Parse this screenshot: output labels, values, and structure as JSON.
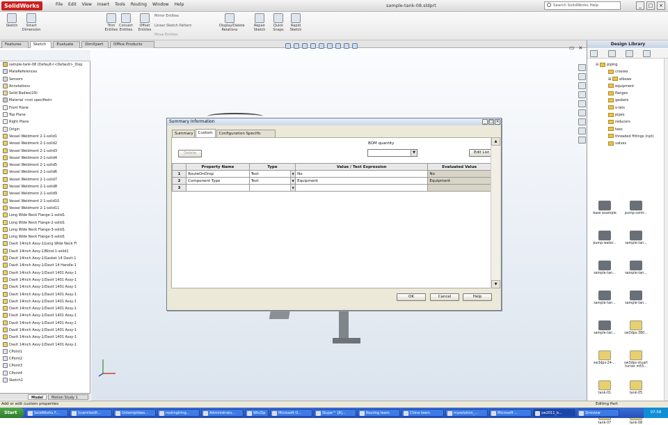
{
  "app": {
    "logo": "SolidWorks",
    "doc_title": "sample-tank-08.sldprt",
    "search_placeholder": "Search SolidWorks Help"
  },
  "menu": [
    "File",
    "Edit",
    "View",
    "Insert",
    "Tools",
    "Routing",
    "Window",
    "Help"
  ],
  "ribbon": {
    "buttons": [
      "Sketch",
      "Smart Dimension",
      "Trim Entities",
      "Convert Entities",
      "Offset Entities",
      "Display/Delete Relations",
      "Repair Sketch",
      "Quick Snaps",
      "Rapid Sketch"
    ],
    "mirror": "Mirror Entities",
    "linear_pattern": "Linear Sketch Pattern",
    "move": "Move Entities"
  },
  "command_tabs": [
    "Features",
    "Sketch",
    "Evaluate",
    "DimXpert",
    "Office Products"
  ],
  "feature_tree": {
    "root": "sample-tank-08  (Default<<Default>_Disp",
    "items": [
      "MateReferences",
      "Sensors",
      "Annotations",
      "Solid Bodies(29)",
      "Material <not specified>",
      "Front Plane",
      "Top Plane",
      "Right Plane",
      "Origin",
      "Vessel Weldment 2-1-solid1",
      "Vessel Weldment 2-1-solid2",
      "Vessel Weldment 2-1-solid3",
      "Vessel Weldment 2-1-solid4",
      "Vessel Weldment 2-1-solid5",
      "Vessel Weldment 2-1-solid6",
      "Vessel Weldment 2-1-solid7",
      "Vessel Weldment 2-1-solid8",
      "Vessel Weldment 2-1-solid9",
      "Vessel Weldment 2-1-solid10",
      "Vessel Weldment 2-1-solid11",
      "Long Wide Neck Flange-1-solid1",
      "Long Wide Neck Flange-2-solid1",
      "Long Wide Neck Flange-3-solid1",
      "Long Wide Neck Flange-5-solid1",
      "Davit 14inch Assy-1/Long Wide Neck Fl",
      "Davit 14inch Assy-1/Blind-1-solid1",
      "Davit 14inch Assy-1/Gasket 14 Davit-1",
      "Davit 14inch Assy-1/Davit 14 Handle-1",
      "Davit 14inch Assy-1/Davit 1401 Assy-1",
      "Davit 14inch Assy-1/Davit 1401 Assy-1",
      "Davit 14inch Assy-1/Davit 1401 Assy-1",
      "Davit 14inch Assy-1/Davit 1401 Assy-1",
      "Davit 14inch Assy-1/Davit 1401 Assy-1",
      "Davit 14inch Assy-1/Davit 1401 Assy-1",
      "Davit 14inch Assy-1/Davit 1401 Assy-1",
      "Davit 14inch Assy-1/Davit 1401 Assy-1",
      "Davit 14inch Assy-1/Davit 1401 Assy-1",
      "Davit 14inch Assy-1/Davit 1401 Assy-1",
      "Davit 14inch Assy-1/Davit 1401 Assy-1",
      "CPoint1",
      "CPoint2",
      "CPoint3",
      "CPoint4",
      "Sketch1"
    ]
  },
  "bottom_tabs": [
    "Model",
    "Motion Study 1"
  ],
  "dialog": {
    "title": "Summary Information",
    "tabs": [
      "Summary",
      "Custom",
      "Configuration Specific"
    ],
    "delete_label": "Delete",
    "bom_label": "BOM quantity",
    "edit_list_label": "Edit List",
    "columns": [
      "Property Name",
      "Type",
      "Value / Text Expression",
      "Evaluated Value"
    ],
    "rows": [
      {
        "n": "1",
        "name": "RouteOnDrop",
        "type": "Text",
        "value": "No",
        "evaluated": "No"
      },
      {
        "n": "2",
        "name": "Component Type",
        "type": "Text",
        "value": "Equipment",
        "evaluated": "Equipment"
      },
      {
        "n": "3",
        "name": "",
        "type": "",
        "value": "",
        "evaluated": ""
      }
    ],
    "ok": "OK",
    "cancel": "Cancel",
    "help": "Help"
  },
  "design_library": {
    "title": "Design Library",
    "tree": [
      "piping",
      "crosses",
      "elbows",
      "equipment",
      "flanges",
      "gaskets",
      "o-lets",
      "pipes",
      "reducers",
      "tees",
      "threaded fittings (npt)",
      "valves"
    ],
    "items": [
      "base example",
      "pump-centr...",
      "pump-water...",
      "sample-tan...",
      "sample-tan...",
      "sample-tan...",
      "sample-tan...",
      "sample-tan...",
      "sample-tan...",
      "sw3dps-380...",
      "sw3dps-24-...",
      "sw3dps-stuart turner m55...",
      "tank-01",
      "tank-05",
      "tank-07",
      "tank-08"
    ]
  },
  "status": {
    "left": "Add or edit custom properties",
    "right": "Editing Part"
  },
  "taskbar": {
    "start": "Start",
    "clock": "07:58",
    "tasks": [
      "SolidWorks F...",
      "\\\\camiloo\\fi...",
      "Untamipldwo...",
      "routingtring...",
      "Administrato...",
      "WinZip",
      "Microsoft O...",
      "Skype™ [8]...",
      "Routing team",
      "China team",
      "mysolution_...",
      "Microsoft ...",
      "sw2011_b...",
      "Streview"
    ]
  }
}
